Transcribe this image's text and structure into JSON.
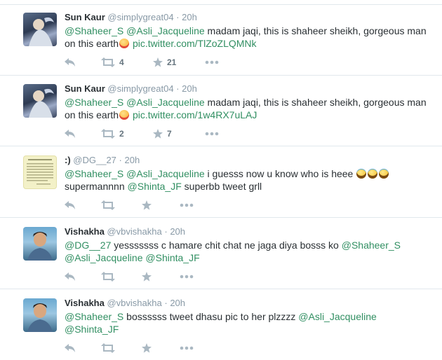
{
  "tweets": [
    {
      "name": "Sun Kaur",
      "handle": "@simplygreat04",
      "time": "20h",
      "segments": [
        {
          "t": "mention",
          "v": "@Shaheer_S"
        },
        {
          "t": "text",
          "v": " "
        },
        {
          "t": "mention",
          "v": "@Asli_Jacqueline"
        },
        {
          "t": "text",
          "v": " madam jaqi, this is shaheer sheikh, gorgeous man on this earth"
        },
        {
          "t": "emoji",
          "v": "smiling-face-emoji"
        },
        {
          "t": "text",
          "v": " "
        },
        {
          "t": "link",
          "v": "pic.twitter.com/TlZoZLQMNk"
        }
      ],
      "retweets": "4",
      "favorites": "21"
    },
    {
      "name": "Sun Kaur",
      "handle": "@simplygreat04",
      "time": "20h",
      "segments": [
        {
          "t": "mention",
          "v": "@Shaheer_S"
        },
        {
          "t": "text",
          "v": " "
        },
        {
          "t": "mention",
          "v": "@Asli_Jacqueline"
        },
        {
          "t": "text",
          "v": " madam jaqi, this is shaheer sheikh, gorgeous man on this earth"
        },
        {
          "t": "emoji",
          "v": "smiling-face-emoji"
        },
        {
          "t": "text",
          "v": " "
        },
        {
          "t": "link",
          "v": "pic.twitter.com/1w4RX7uLAJ"
        }
      ],
      "retweets": "2",
      "favorites": "7"
    },
    {
      "name": ":)",
      "handle": "@DG__27",
      "time": "20h",
      "segments": [
        {
          "t": "mention",
          "v": "@Shaheer_S"
        },
        {
          "t": "text",
          "v": " "
        },
        {
          "t": "mention",
          "v": "@Asli_Jacqueline"
        },
        {
          "t": "text",
          "v": " i guesss now u know who is heee "
        },
        {
          "t": "emoji",
          "v": "laughing-emoji"
        },
        {
          "t": "emoji",
          "v": "laughing-emoji"
        },
        {
          "t": "emoji",
          "v": "laughing-emoji"
        },
        {
          "t": "text",
          "v": " supermannnn  "
        },
        {
          "t": "mention",
          "v": "@Shinta_JF"
        },
        {
          "t": "text",
          "v": " superbb tweet grll"
        }
      ],
      "retweets": "",
      "favorites": ""
    },
    {
      "name": "Vishakha",
      "handle": "@vbvishakha",
      "time": "20h",
      "segments": [
        {
          "t": "mention",
          "v": "@DG__27"
        },
        {
          "t": "text",
          "v": " yesssssss c hamare chit chat ne jaga diya bosss ko "
        },
        {
          "t": "mention",
          "v": "@Shaheer_S"
        },
        {
          "t": "text",
          "v": " "
        },
        {
          "t": "mention",
          "v": "@Asli_Jacqueline"
        },
        {
          "t": "text",
          "v": " "
        },
        {
          "t": "mention",
          "v": "@Shinta_JF"
        }
      ],
      "retweets": "",
      "favorites": ""
    },
    {
      "name": "Vishakha",
      "handle": "@vbvishakha",
      "time": "20h",
      "segments": [
        {
          "t": "mention",
          "v": "@Shaheer_S"
        },
        {
          "t": "text",
          "v": " bossssss tweet dhasu pic to her plzzzz  "
        },
        {
          "t": "mention",
          "v": "@Asli_Jacqueline"
        },
        {
          "t": "text",
          "v": " "
        },
        {
          "t": "mention",
          "v": "@Shinta_JF"
        }
      ],
      "retweets": "",
      "favorites": ""
    }
  ],
  "colors": {
    "mention": "#318f62",
    "link": "#318f62",
    "separator": "#e1e8ed",
    "action_icon": "#aab8c2"
  }
}
